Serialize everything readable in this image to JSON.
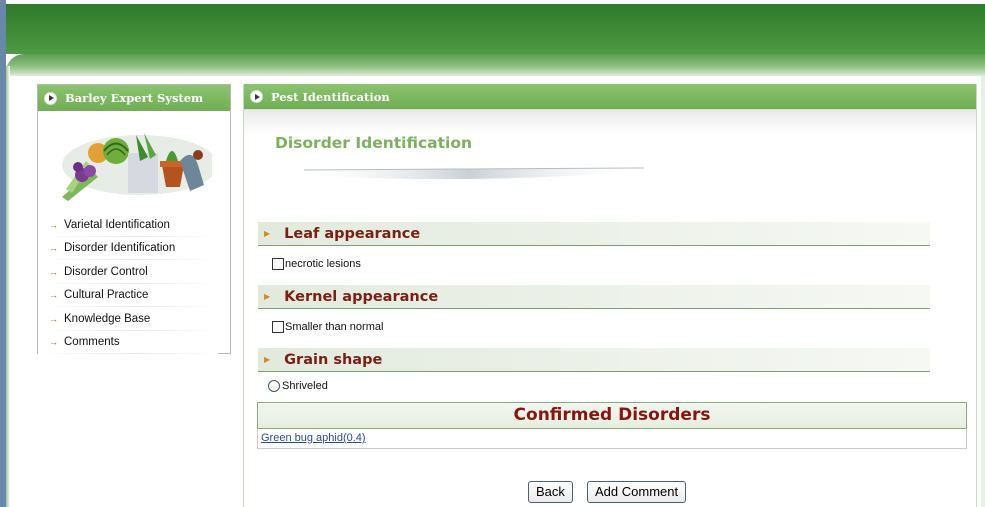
{
  "sidebar": {
    "title": "Barley Expert System",
    "items": [
      {
        "label": "Varietal Identification"
      },
      {
        "label": "Disorder Identification"
      },
      {
        "label": "Disorder Control"
      },
      {
        "label": "Cultural Practice"
      },
      {
        "label": "Knowledge Base"
      },
      {
        "label": "Comments"
      }
    ]
  },
  "main": {
    "header": "Pest Identification",
    "page_title": "Disorder Identification",
    "sections": [
      {
        "title": "Leaf appearance",
        "option": "necrotic lesions",
        "control": "checkbox"
      },
      {
        "title": "Kernel appearance",
        "option": "Smaller than normal",
        "control": "checkbox"
      },
      {
        "title": "Grain shape",
        "option": "Shriveled",
        "control": "radio"
      }
    ],
    "confirmed_title": "Confirmed Disorders",
    "confirmed_results": [
      {
        "name": "Green bug aphid",
        "score": "(0.4)"
      }
    ],
    "buttons": {
      "back": "Back",
      "add_comment": "Add Comment"
    }
  },
  "colors": {
    "banner_green": "#3e8b37",
    "panel_header_green": "#7db860",
    "section_title": "#7a1f13",
    "confirmed_title": "#8a1510",
    "link": "#2b4c94"
  }
}
